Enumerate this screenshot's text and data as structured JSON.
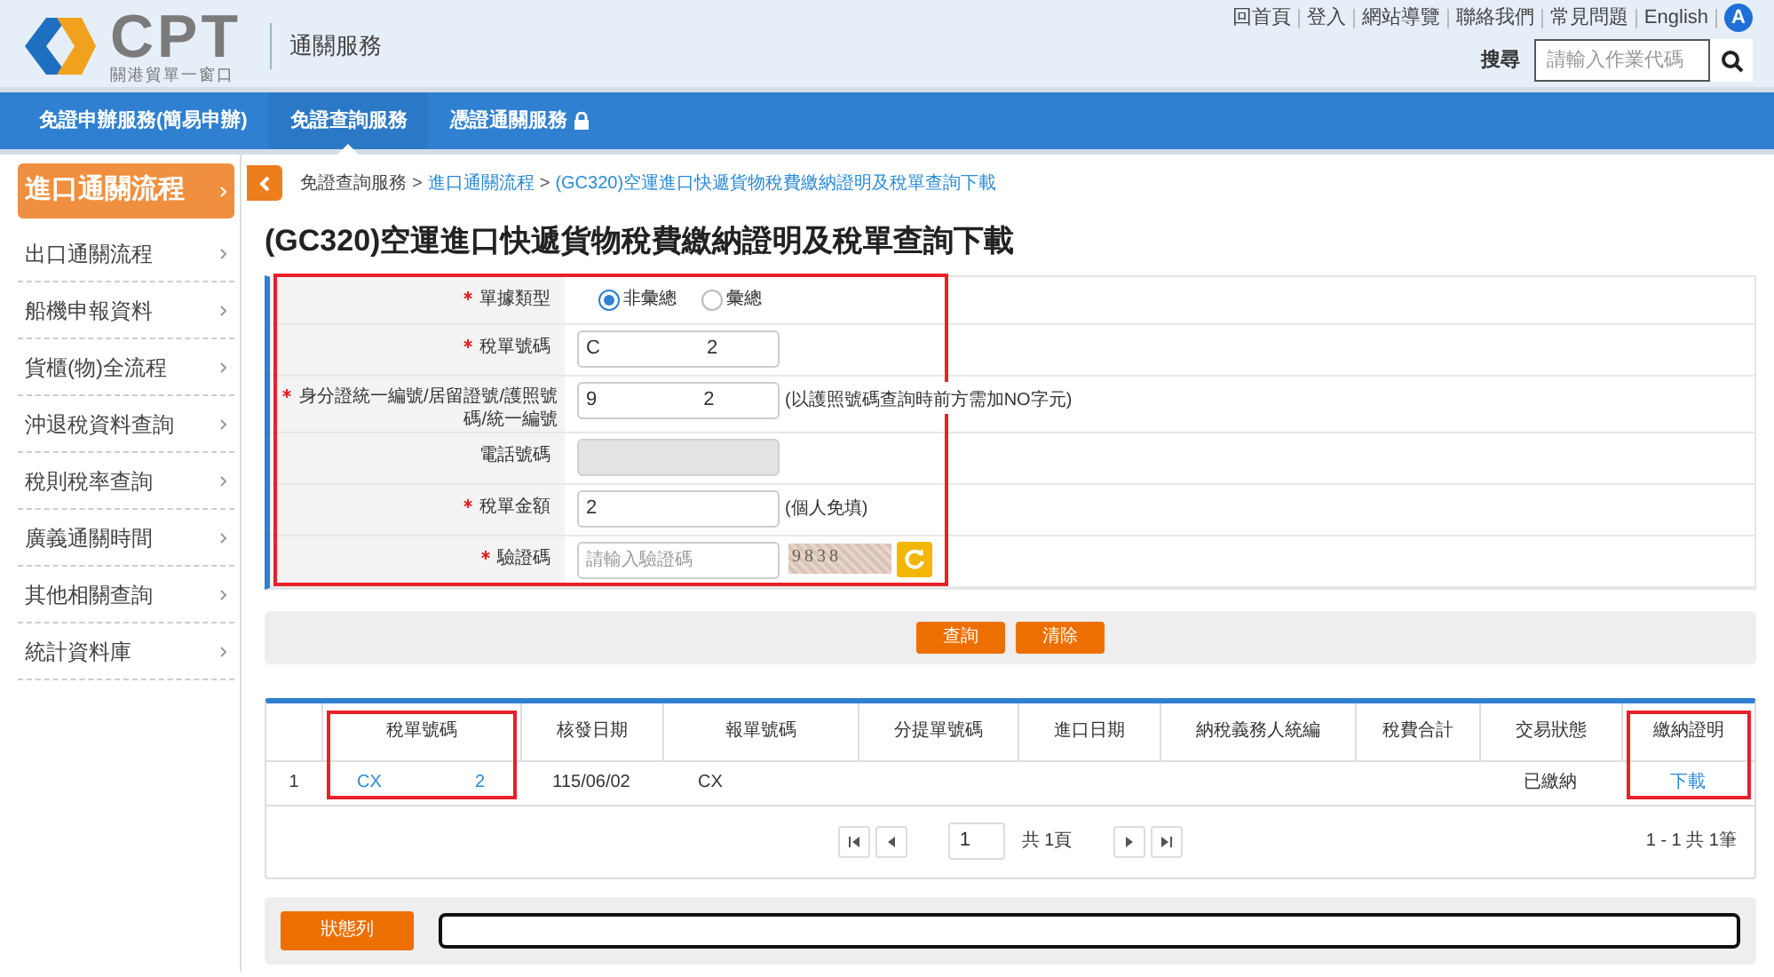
{
  "logo": {
    "name": "CPT",
    "subtitle": "關港貿單一窗口"
  },
  "site_title": "通關服務",
  "top_links": [
    "回首頁",
    "登入",
    "網站導覽",
    "聯絡我們",
    "常見問題",
    "English"
  ],
  "accessibility_badge": "A",
  "search": {
    "label": "搜尋",
    "placeholder": "請輸入作業代碼"
  },
  "nav": [
    {
      "label": "免證申辦服務(簡易申辦)",
      "selected": false,
      "locked": false
    },
    {
      "label": "免證查詢服務",
      "selected": true,
      "locked": false
    },
    {
      "label": "憑證通關服務",
      "selected": false,
      "locked": true
    }
  ],
  "sidebar": [
    {
      "label": "進口通關流程",
      "selected": true
    },
    {
      "label": "出口通關流程",
      "selected": false
    },
    {
      "label": "船機申報資料",
      "selected": false
    },
    {
      "label": "貨櫃(物)全流程",
      "selected": false
    },
    {
      "label": "沖退稅資料查詢",
      "selected": false
    },
    {
      "label": "稅則稅率查詢",
      "selected": false
    },
    {
      "label": "廣義通關時間",
      "selected": false
    },
    {
      "label": "其他相關查詢",
      "selected": false
    },
    {
      "label": "統計資料庫",
      "selected": false
    }
  ],
  "breadcrumb": [
    {
      "label": "免證查詢服務"
    },
    {
      "separator": ">",
      "label": "進口通關流程"
    },
    {
      "separator": ">",
      "label": "(GC320)空運進口快遞貨物稅費繳納證明及稅單查詢下載"
    }
  ],
  "page_title": "(GC320)空運進口快遞貨物稅費繳納證明及稅單查詢下載",
  "form": {
    "highlighted": true,
    "rows": [
      {
        "kind": "radio",
        "label": "單據類型",
        "required": true,
        "options": [
          {
            "label": "非彙總",
            "selected": true
          },
          {
            "label": "彙總",
            "selected": false
          }
        ]
      },
      {
        "kind": "text",
        "label": "稅單號碼",
        "required": true,
        "value_parts": [
          "C",
          "2"
        ]
      },
      {
        "kind": "text",
        "label": "身分證統一編號/居留證號/護照號碼/統一編號",
        "required": true,
        "value_parts": [
          "9",
          "2"
        ],
        "note": "(以護照號碼查詢時前方需加NO字元)"
      },
      {
        "kind": "text",
        "label": "電話號碼",
        "required": false,
        "disabled": true
      },
      {
        "kind": "text",
        "label": "稅單金額",
        "required": true,
        "value_parts": [
          "2"
        ],
        "note": "(個人免填)"
      },
      {
        "kind": "captcha",
        "label": "驗證碼",
        "required": true,
        "placeholder": "請輸入驗證碼",
        "captcha": "9838"
      }
    ]
  },
  "buttons": [
    "查詢",
    "清除"
  ],
  "table": {
    "columns": [
      {
        "highlighted": false
      },
      {
        "label": "稅單號碼",
        "highlighted": true
      },
      {
        "label": "核發日期",
        "highlighted": false
      },
      {
        "label": "報單號碼",
        "highlighted": false
      },
      {
        "label": "分提單號碼",
        "highlighted": false
      },
      {
        "label": "進口日期",
        "highlighted": false
      },
      {
        "label": "納稅義務人統編",
        "highlighted": false
      },
      {
        "label": "稅費合計",
        "highlighted": false
      },
      {
        "label": "交易狀態",
        "highlighted": false
      },
      {
        "label": "繳納證明",
        "highlighted": true
      }
    ],
    "rows": [
      {
        "index": "1",
        "tax_bill_no": [
          "CX",
          "2"
        ],
        "issue_date": "115/06/02",
        "declaration_no": "CX",
        "status": "已繳納",
        "certificate": "下載"
      }
    ]
  },
  "pagination": {
    "page": "1",
    "total_pages": "共 1頁",
    "summary": "1 - 1 共 1筆"
  },
  "status_bar": {
    "label": "狀態列"
  }
}
